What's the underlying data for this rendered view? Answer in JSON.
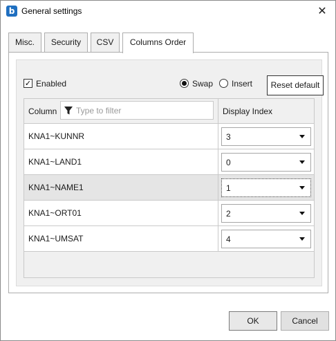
{
  "window": {
    "title": "General settings",
    "app_icon_letter": "b",
    "close_glyph": "✕"
  },
  "tabs": [
    {
      "label": "Misc.",
      "active": false
    },
    {
      "label": "Security",
      "active": false
    },
    {
      "label": "CSV",
      "active": false
    },
    {
      "label": "Columns Order",
      "active": true
    }
  ],
  "options": {
    "enabled_label": "Enabled",
    "enabled_checked": true,
    "swap_label": "Swap",
    "swap_selected": true,
    "insert_label": "Insert",
    "insert_selected": false,
    "reset_label": "Reset default"
  },
  "grid": {
    "column_header": "Column",
    "filter_placeholder": "Type to filter",
    "filter_value": "",
    "display_index_header": "Display Index",
    "rows": [
      {
        "name": "KNA1~KUNNR",
        "index": "3",
        "selected": false
      },
      {
        "name": "KNA1~LAND1",
        "index": "0",
        "selected": false
      },
      {
        "name": "KNA1~NAME1",
        "index": "1",
        "selected": true
      },
      {
        "name": "KNA1~ORT01",
        "index": "2",
        "selected": false
      },
      {
        "name": "KNA1~UMSAT",
        "index": "4",
        "selected": false
      }
    ]
  },
  "footer": {
    "ok_label": "OK",
    "cancel_label": "Cancel"
  }
}
